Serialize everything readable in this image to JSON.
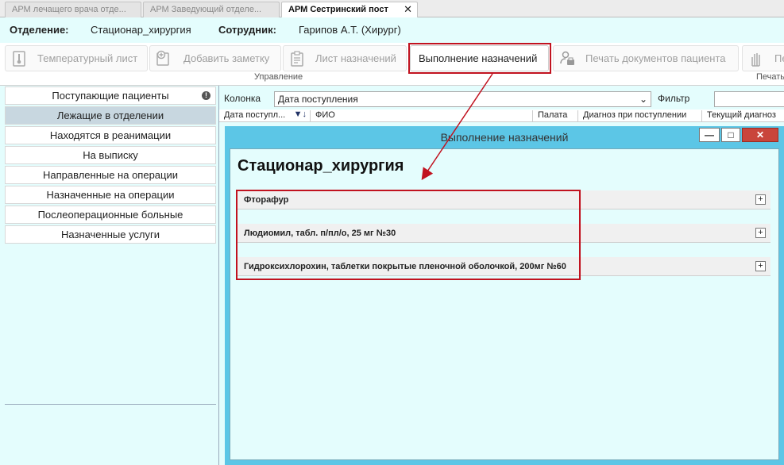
{
  "tabs": [
    {
      "label": "АРМ лечащего врача отде..."
    },
    {
      "label": "АРМ Заведующий отделе..."
    },
    {
      "label": "АРМ Сестринский пост",
      "close": "✕"
    }
  ],
  "info": {
    "dept_label": "Отделение:",
    "dept_value": "Стационар_хирургия",
    "staff_label": "Сотрудник:",
    "staff_value": "Гарипов А.Т. (Хирург)"
  },
  "toolbar": {
    "temp_sheet": "Температурный лист",
    "add_note": "Добавить заметку",
    "orders_sheet": "Лист назначений",
    "execute_orders": "Выполнение назначений",
    "print_docs": "Печать документов пациента",
    "print_cut": "Пе",
    "group_manage": "Управление",
    "group_print": "Печать"
  },
  "sidebar": {
    "items": [
      {
        "label": "Поступающие пациенты",
        "badge": "!"
      },
      {
        "label": "Лежащие в отделении"
      },
      {
        "label": "Находятся в реанимации"
      },
      {
        "label": "На выписку"
      },
      {
        "label": "Направленные на операции"
      },
      {
        "label": "Назначенные на операции"
      },
      {
        "label": "Послеоперационные больные"
      },
      {
        "label": "Назначенные услуги"
      }
    ]
  },
  "filter": {
    "column_label": "Колонка",
    "column_value": "Дата поступления",
    "filter_label": "Фильтр"
  },
  "grid": {
    "headers": [
      "Дата поступл...",
      "ФИО",
      "Палата",
      "Диагноз при поступлении",
      "Текущий диагноз"
    ]
  },
  "dialog": {
    "title": "Выполнение назначений",
    "heading": "Стационар_хирургия",
    "minimize": "—",
    "maximize": "□",
    "close": "✕",
    "meds": [
      {
        "label": "Фторафур"
      },
      {
        "label": "Людиомил, табл. п/пл/о, 25 мг №30"
      },
      {
        "label": "Гидроксихлорохин, таблетки покрытые пленочной оболочкой, 200мг №60"
      }
    ],
    "expand_glyph": "+"
  },
  "colors": {
    "panel_bg": "#e4fdfd",
    "dialog_frame": "#5cc6e6",
    "highlight": "#c1121f"
  }
}
